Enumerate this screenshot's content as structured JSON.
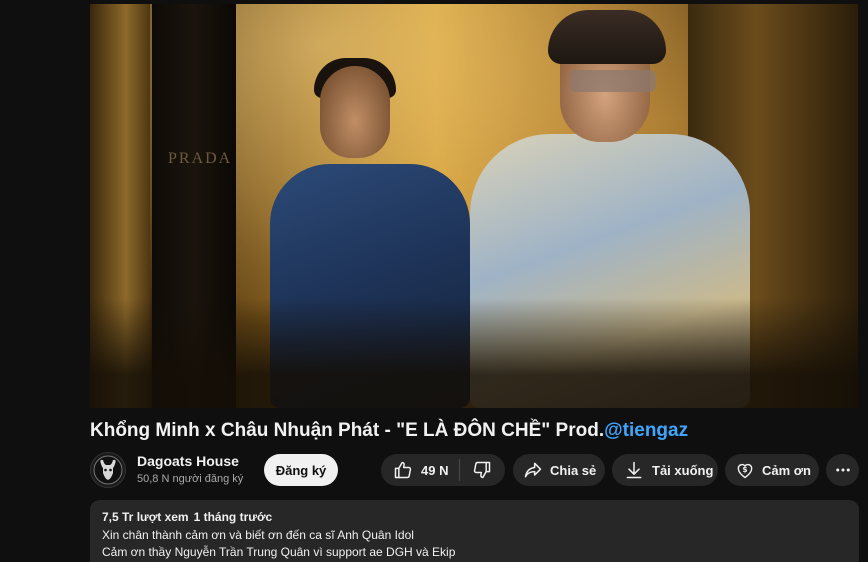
{
  "video": {
    "title_main": "Khổng Minh x Châu Nhuận Phát - \"E LÀ ĐÔN CHỀ\" Prod.",
    "title_handle": "@tiengaz",
    "frame_sign_text": "PRADA"
  },
  "channel": {
    "name": "Dagoats House",
    "subscribers": "50,8 N người đăng ký",
    "subscribe_label": "Đăng ký"
  },
  "actions": {
    "like_count": "49 N",
    "share_label": "Chia sẻ",
    "download_label": "Tải xuống",
    "thanks_label": "Cảm ơn",
    "like_icon": "thumbs-up-icon",
    "dislike_icon": "thumbs-down-icon",
    "share_icon": "share-arrow-icon",
    "download_icon": "download-icon",
    "thanks_icon": "dollar-heart-icon",
    "more_icon": "more-horizontal-icon"
  },
  "description": {
    "views": "7,5 Tr lượt xem",
    "date": "1 tháng trước",
    "lines": [
      "Xin chân thành cảm ơn và biết ơn đến ca sĩ Anh Quân Idol",
      "Cảm ơn thầy Nguyễn Trần Trung Quân vì support ae DGH và Ekip"
    ]
  },
  "colors": {
    "background": "#0f0f0f",
    "pill": "#272727",
    "text": "#f1f1f1",
    "secondary_text": "#aaaaaa",
    "link": "#3ea6ff"
  }
}
